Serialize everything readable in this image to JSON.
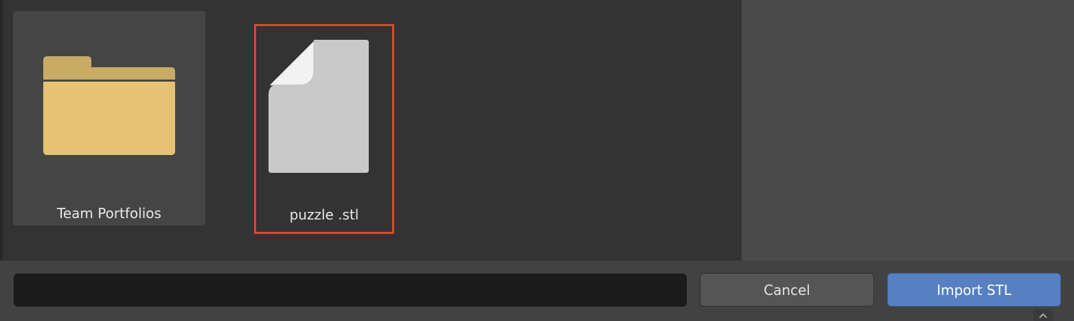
{
  "files": [
    {
      "label": "Team Portfolios",
      "type": "folder",
      "icon": "folder-icon"
    },
    {
      "label": "puzzle .stl",
      "type": "file",
      "icon": "file-icon",
      "selected": true
    }
  ],
  "footer": {
    "filename_value": "",
    "cancel_label": "Cancel",
    "import_label": "Import STL"
  },
  "colors": {
    "selection_outline": "#e0472f",
    "import_button": "#5680c2",
    "folder": "#e5c373"
  }
}
